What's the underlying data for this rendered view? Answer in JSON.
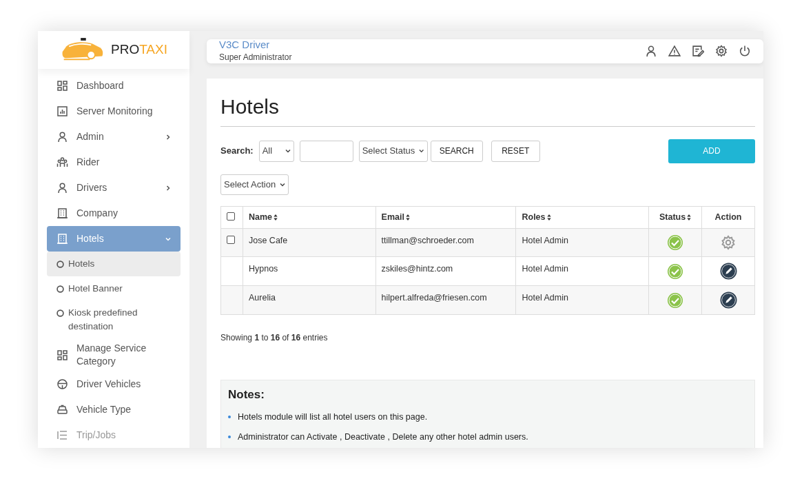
{
  "brand": {
    "part1": "PRO",
    "part2": "TAXI"
  },
  "sidebar": {
    "items": [
      {
        "label": "Dashboard",
        "has_submenu": false,
        "selected": false
      },
      {
        "label": "Server Monitoring",
        "has_submenu": false,
        "selected": false
      },
      {
        "label": "Admin",
        "has_submenu": true,
        "selected": false
      },
      {
        "label": "Rider",
        "has_submenu": false,
        "selected": false
      },
      {
        "label": "Drivers",
        "has_submenu": true,
        "selected": false
      },
      {
        "label": "Company",
        "has_submenu": false,
        "selected": false
      },
      {
        "label": "Hotels",
        "has_submenu": true,
        "selected": true,
        "expanded": true,
        "children": [
          {
            "label": "Hotels",
            "selected": true
          },
          {
            "label": "Hotel Banner",
            "selected": false
          },
          {
            "label": "Kiosk predefined destination",
            "selected": false
          }
        ]
      },
      {
        "label": "Manage Service Category",
        "has_submenu": false,
        "selected": false
      },
      {
        "label": "Driver Vehicles",
        "has_submenu": false,
        "selected": false
      },
      {
        "label": "Vehicle Type",
        "has_submenu": false,
        "selected": false
      },
      {
        "label": "Trip/Jobs",
        "has_submenu": false,
        "selected": false
      }
    ]
  },
  "header": {
    "user": "V3C Driver",
    "role": "Super Administrator"
  },
  "page": {
    "title": "Hotels",
    "filters": {
      "label": "Search:",
      "type_select": "All",
      "status_select": "Select Status",
      "search_button": "SEARCH",
      "reset_button": "RESET",
      "add_button": "ADD",
      "action_select": "Select Action"
    },
    "table": {
      "columns": [
        {
          "label": "Name",
          "sortable": true
        },
        {
          "label": "Email",
          "sortable": true
        },
        {
          "label": "Roles",
          "sortable": true
        },
        {
          "label": "Status",
          "sortable": true
        },
        {
          "label": "Action",
          "sortable": false
        }
      ],
      "header_checked": false,
      "rows": [
        {
          "name": "Jose Cafe",
          "email": "ttillman@schroeder.com",
          "role": "Hotel Admin",
          "active": true,
          "has_checkbox": true,
          "checked": false,
          "kind": "settings"
        },
        {
          "name": "Hypnos",
          "email": "zskiles@hintz.com",
          "role": "Hotel Admin",
          "active": true,
          "has_checkbox": false,
          "kind": "edit"
        },
        {
          "name": "Aurelia",
          "email": "hilpert.alfreda@friesen.com",
          "role": "Hotel Admin",
          "active": true,
          "has_checkbox": false,
          "kind": "edit"
        }
      ]
    },
    "summary": "Showing **1** to **16** of **16** entries",
    "notes": {
      "title": "Notes:",
      "items": [
        "Hotels module will list all hotel users on this page.",
        "Administrator can Activate , Deactivate , Delete any other hotel admin users."
      ]
    }
  }
}
